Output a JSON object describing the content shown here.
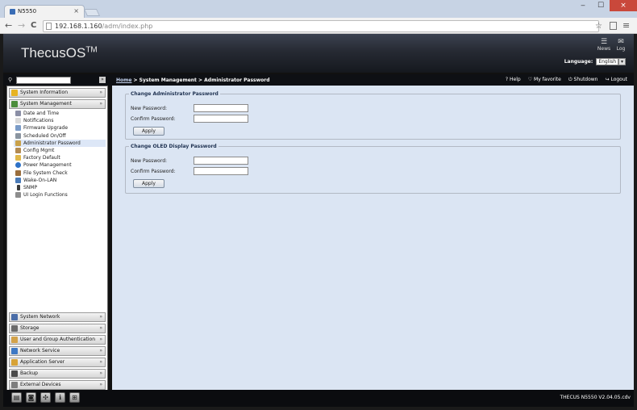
{
  "browser": {
    "tab_title": "N5550",
    "tab_close": "×",
    "back": "←",
    "forward": "→",
    "reload": "C",
    "url_host": "192.168.1.160",
    "url_path": "/adm/index.php",
    "star": "☆",
    "menu": "≡",
    "window_buttons": [
      "‒",
      "☐",
      "×"
    ]
  },
  "header": {
    "logo": "ThecusOS",
    "logo_tm": "TM",
    "news_label": "News",
    "logout_label": "Log",
    "language_label": "Language:",
    "language_value": "English",
    "language_arrow": "▾"
  },
  "navbar": {
    "search_value": "",
    "search_button": "»",
    "breadcrumb_home": "Home",
    "breadcrumb_rest": " > System Management > Administrator Password",
    "help": "Help",
    "favorite": "My favorite",
    "shutdown": "Shutdown",
    "logout": "Logout"
  },
  "sidebar": {
    "top_categories": [
      {
        "label": "System Information",
        "icon_color": "#e7b322"
      },
      {
        "label": "System Management",
        "icon_color": "#4c8d3c"
      }
    ],
    "items": [
      {
        "label": "Date and Time",
        "icon_color": "#8b8fa6"
      },
      {
        "label": "Notifications",
        "icon_color": "#d9d9d9"
      },
      {
        "label": "Firmware Upgrade",
        "icon_color": "#7a9bc7"
      },
      {
        "label": "Scheduled On/Off",
        "icon_color": "#8a94a0"
      },
      {
        "label": "Administrator Password",
        "icon_color": "#c9a14a"
      },
      {
        "label": "Config Mgmt",
        "icon_color": "#b38b52"
      },
      {
        "label": "Factory Default",
        "icon_color": "#e0b84a"
      },
      {
        "label": "Power Management",
        "icon_color": "#2e72c7"
      },
      {
        "label": "File System Check",
        "icon_color": "#9a6e3d"
      },
      {
        "label": "Wake-On-LAN",
        "icon_color": "#4a7bb8"
      },
      {
        "label": "SNMP",
        "icon_color": "#3a3a3a"
      },
      {
        "label": "UI Login Functions",
        "icon_color": "#8d8d8d"
      }
    ],
    "bottom_categories": [
      {
        "label": "System Network",
        "icon_color": "#4a6da8"
      },
      {
        "label": "Storage",
        "icon_color": "#6b6b6b"
      },
      {
        "label": "User and Group Authentication",
        "icon_color": "#d2a24a"
      },
      {
        "label": "Network Service",
        "icon_color": "#3d78c4"
      },
      {
        "label": "Application Server",
        "icon_color": "#d7a236"
      },
      {
        "label": "Backup",
        "icon_color": "#4b4b4b"
      },
      {
        "label": "External Devices",
        "icon_color": "#7e7e7e"
      }
    ],
    "chevron": "»"
  },
  "content": {
    "admin": {
      "legend": "Change Administrator Password",
      "new_label": "New Password:",
      "confirm_label": "Confirm Password:",
      "new_value": "",
      "confirm_value": "",
      "apply": "Apply"
    },
    "oled": {
      "legend": "Change OLED Display Password",
      "new_label": "New Password:",
      "confirm_label": "Confirm Password:",
      "new_value": "",
      "confirm_value": "",
      "apply": "Apply"
    }
  },
  "footer": {
    "buttons": [
      "▤",
      "◙",
      "✣",
      "ℹ",
      "⊞"
    ],
    "version": "THECUS N5550 V2.04.05.cdv"
  }
}
